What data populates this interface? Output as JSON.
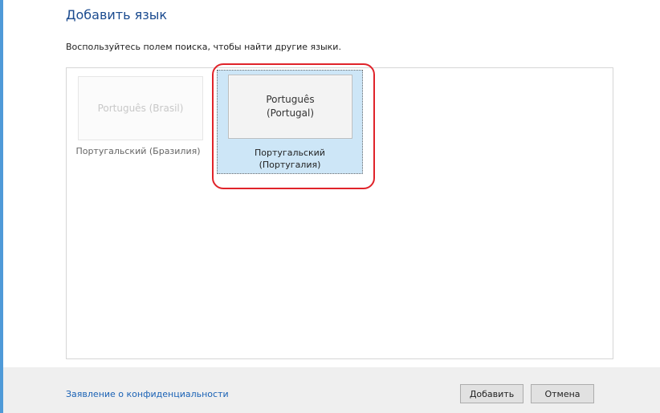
{
  "dialog": {
    "title": "Добавить язык",
    "subtitle": "Воспользуйтесь полем поиска, чтобы найти другие языки."
  },
  "languages": [
    {
      "native": "Português (Brasil)",
      "localized": "Португальский (Бразилия)",
      "selected": false
    },
    {
      "native": "Português (Portugal)",
      "localized": "Португальский (Португалия)",
      "selected": true
    }
  ],
  "footer": {
    "privacy_link": "Заявление о конфиденциальности",
    "add_button": "Добавить",
    "cancel_button": "Отмена"
  },
  "colors": {
    "accent_stripe": "#4f9ad8",
    "selection_background": "#cde6f7",
    "highlight_ring": "#e0232a",
    "link": "#1a62b5"
  }
}
